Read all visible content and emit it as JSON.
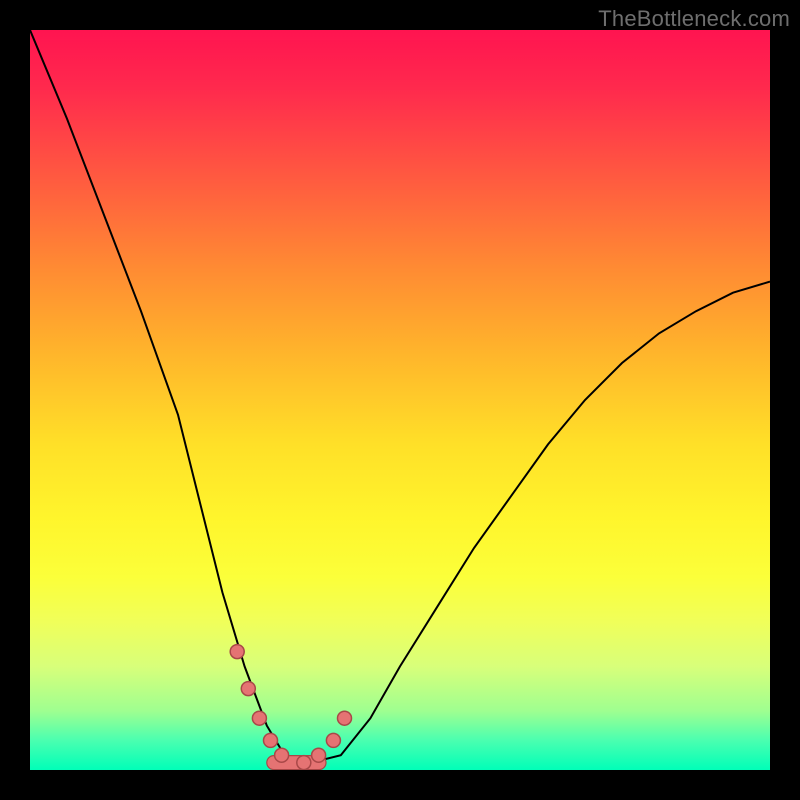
{
  "watermark": "TheBottleneck.com",
  "chart_data": {
    "type": "line",
    "title": "",
    "xlabel": "",
    "ylabel": "",
    "xlim": [
      0,
      100
    ],
    "ylim": [
      0,
      100
    ],
    "grid": false,
    "legend": false,
    "background_gradient": {
      "top": "#ff1450",
      "bottom": "#00ffb8",
      "description": "red (high bottleneck) to green (no bottleneck)"
    },
    "series": [
      {
        "name": "bottleneck-curve",
        "x": [
          0,
          5,
          10,
          15,
          20,
          23,
          26,
          29,
          32,
          35,
          38,
          42,
          46,
          50,
          55,
          60,
          65,
          70,
          75,
          80,
          85,
          90,
          95,
          100
        ],
        "y": [
          100,
          88,
          75,
          62,
          48,
          36,
          24,
          14,
          6,
          1,
          1,
          2,
          7,
          14,
          22,
          30,
          37,
          44,
          50,
          55,
          59,
          62,
          64.5,
          66
        ]
      }
    ],
    "markers": {
      "name": "highlighted-points",
      "x": [
        28,
        29.5,
        31,
        32.5,
        34,
        37,
        39,
        41,
        42.5
      ],
      "y": [
        16,
        11,
        7,
        4,
        2,
        1,
        2,
        4,
        7
      ]
    },
    "floor_band": {
      "xmin": 32,
      "xmax": 40,
      "y": 1
    }
  }
}
